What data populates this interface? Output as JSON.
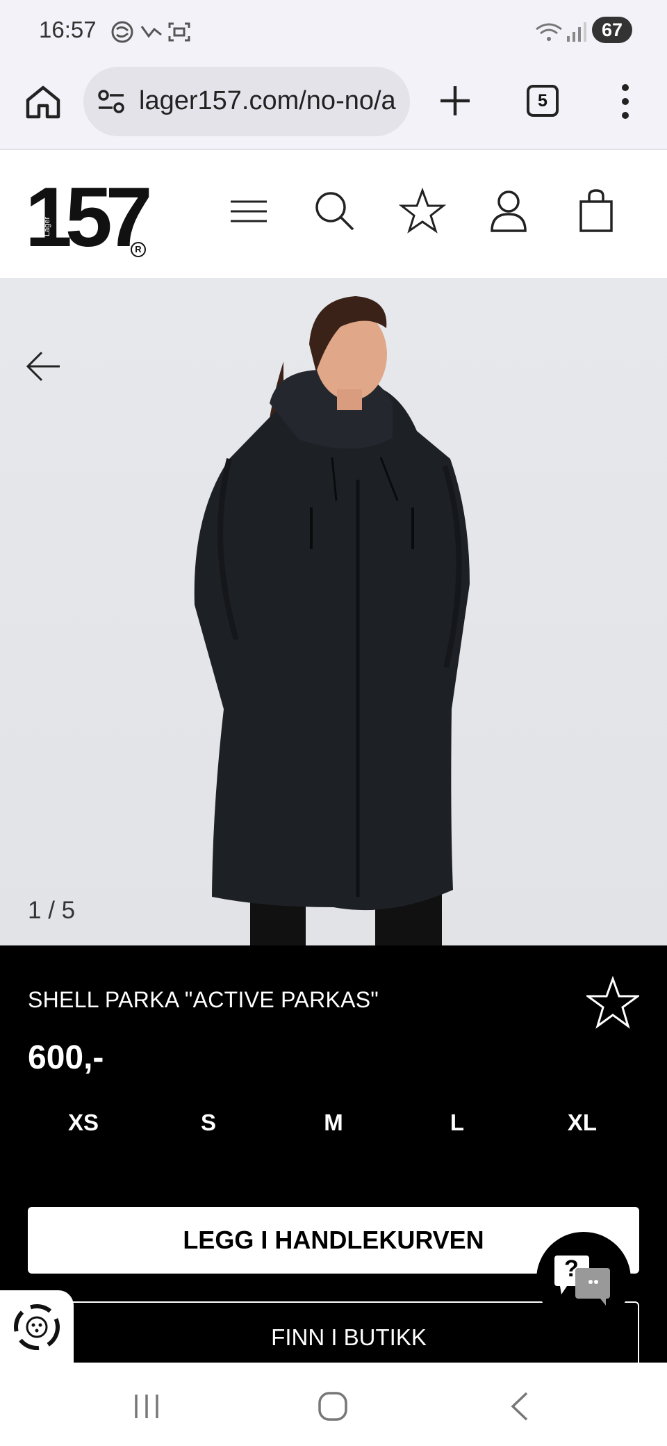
{
  "status_bar": {
    "time": "16:57",
    "battery": "67"
  },
  "browser": {
    "url": "lager157.com/no-no/a",
    "tab_count": "5"
  },
  "site": {
    "logo_number": "157",
    "logo_word": "Lager",
    "logo_reg": "R"
  },
  "gallery": {
    "counter": "1 / 5"
  },
  "product": {
    "title": "SHELL PARKA \"ACTIVE PARKAS\"",
    "price": "600,-",
    "sizes": [
      "XS",
      "S",
      "M",
      "L",
      "XL"
    ],
    "add_to_cart": "LEGG I HANDLEKURVEN",
    "find_in_store": "FINN I BUTIKK"
  },
  "chat": {
    "glyph": "?"
  },
  "colors": {
    "panel_bg": "#000000",
    "hero_bg": "#e4e6ea",
    "accent": "#ffffff"
  }
}
